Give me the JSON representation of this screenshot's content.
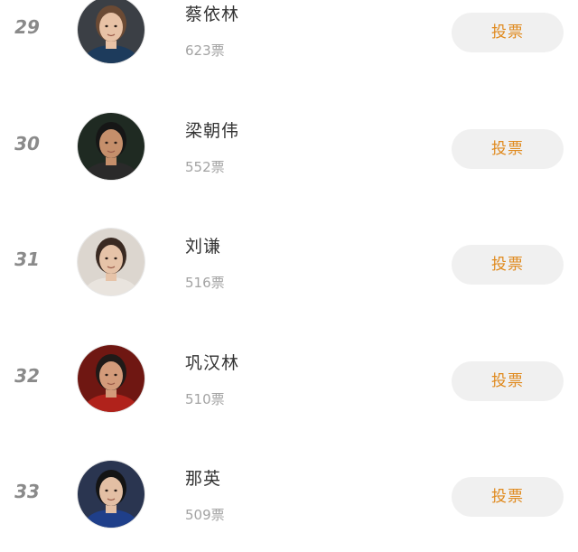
{
  "ranking": {
    "rows": [
      {
        "rank": "29",
        "name": "蔡依林",
        "votes": "623票",
        "vote_label": "投票",
        "avatar": {
          "bg": "#3b3f45",
          "skin": "#e8c2a6",
          "hair": "#6b4a34",
          "cloth": "#1d3b5c"
        }
      },
      {
        "rank": "30",
        "name": "梁朝伟",
        "votes": "552票",
        "vote_label": "投票",
        "avatar": {
          "bg": "#1f2a22",
          "skin": "#c58f6b",
          "hair": "#161616",
          "cloth": "#2a2a2a"
        }
      },
      {
        "rank": "31",
        "name": "刘谦",
        "votes": "516票",
        "vote_label": "投票",
        "avatar": {
          "bg": "#dcd6cf",
          "skin": "#e6c3a8",
          "hair": "#3a2a22",
          "cloth": "#e9e4de"
        }
      },
      {
        "rank": "32",
        "name": "巩汉林",
        "votes": "510票",
        "vote_label": "投票",
        "avatar": {
          "bg": "#6f1712",
          "skin": "#d39b7a",
          "hair": "#1f1a18",
          "cloth": "#b0221b"
        }
      },
      {
        "rank": "33",
        "name": "那英",
        "votes": "509票",
        "vote_label": "投票",
        "avatar": {
          "bg": "#2a3550",
          "skin": "#e3bfa4",
          "hair": "#141414",
          "cloth": "#1f3f8a"
        }
      }
    ]
  }
}
